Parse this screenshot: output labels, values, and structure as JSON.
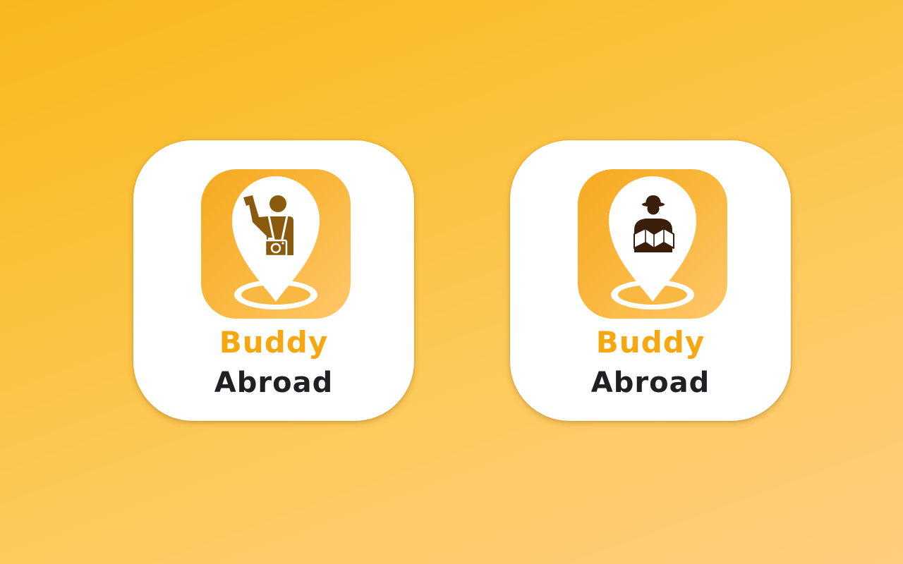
{
  "logos": [
    {
      "variant": "tourist-with-camera",
      "icon": "tourist-camera-pin-icon",
      "word_1": "Buddy",
      "word_2": "Abroad"
    },
    {
      "variant": "explorer-with-map",
      "icon": "explorer-map-pin-icon",
      "word_1": "Buddy",
      "word_2": "Abroad"
    }
  ],
  "colors": {
    "background_start": "#f8b81c",
    "background_end": "#ffcd7c",
    "card": "#ffffff",
    "tile_start": "#f5a920",
    "tile_end": "#ffc76a",
    "figure": "#8a5a0e",
    "word_1": "#f7a70f",
    "word_2": "#1f1f24"
  }
}
